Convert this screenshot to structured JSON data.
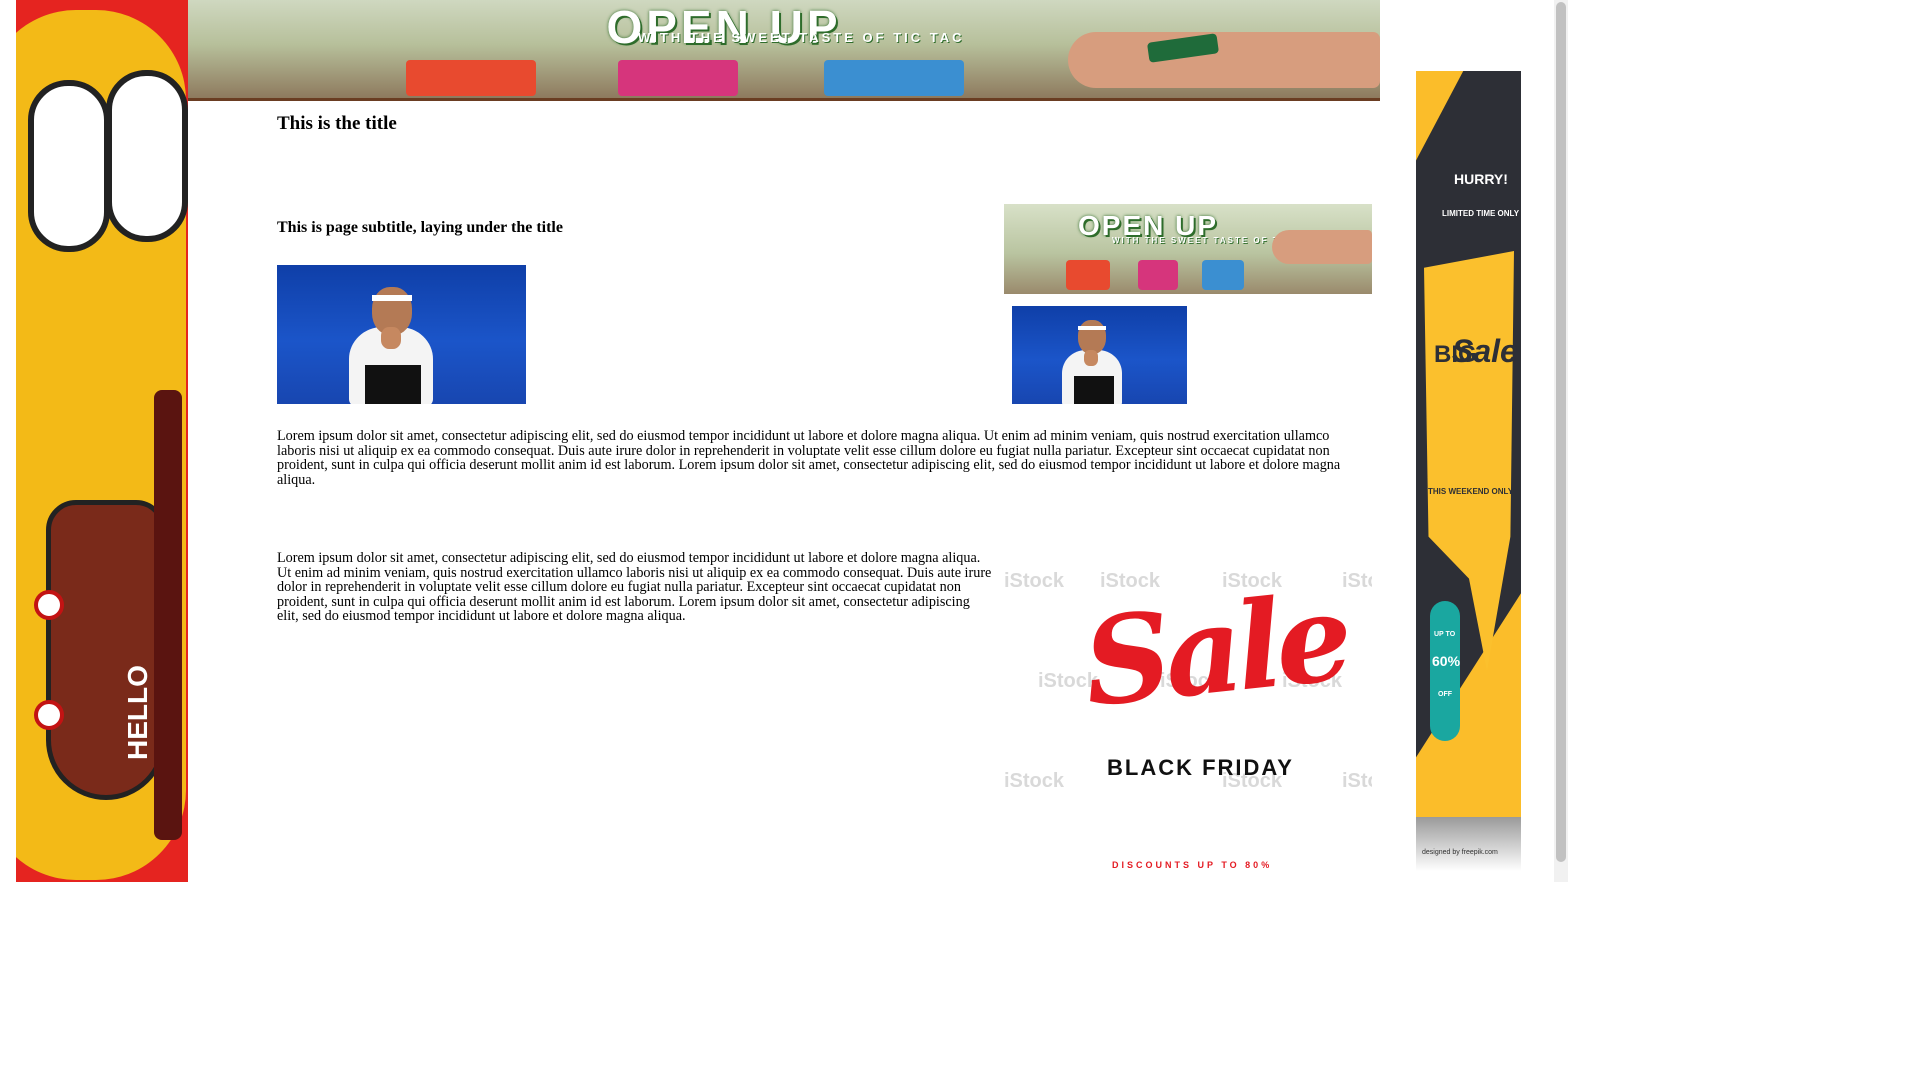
{
  "page": {
    "title": "This is the title",
    "subtitle": "This is page subtitle, laying under the title",
    "paragraphs": [
      "Lorem ipsum dolor sit amet, consectetur adipiscing elit, sed do eiusmod tempor incididunt ut labore et dolore magna aliqua. Ut enim ad minim veniam, quis nostrud exercitation ullamco laboris nisi ut aliquip ex ea commodo consequat. Duis aute irure dolor in reprehenderit in voluptate velit esse cillum dolore eu fugiat nulla pariatur. Excepteur sint occaecat cupidatat non proident, sunt in culpa qui officia deserunt mollit anim id est laborum. Lorem ipsum dolor sit amet, consectetur adipiscing elit, sed do eiusmod tempor incididunt ut labore et dolore magna aliqua.",
      "Lorem ipsum dolor sit amet, consectetur adipiscing elit, sed do eiusmod tempor incididunt ut labore et dolore magna aliqua. Ut enim ad minim veniam, quis nostrud exercitation ullamco laboris nisi ut aliquip ex ea commodo consequat. Duis aute irure dolor in reprehenderit in voluptate velit esse cillum dolore eu fugiat nulla pariatur. Excepteur sint occaecat cupidatat non proident, sunt in culpa qui officia deserunt mollit anim id est laborum. Lorem ipsum dolor sit amet, consectetur adipiscing elit, sed do eiusmod tempor incididunt ut labore et dolore magna aliqua."
    ]
  },
  "ads": {
    "tictac": {
      "headline": "OPEN UP",
      "tagline": "WITH THE SWEET TASTE OF TIC TAC",
      "brand": "tic tac",
      "colors": [
        "#e84a2f",
        "#d6357c",
        "#3b8fd1"
      ]
    },
    "left_skyscraper": {
      "text": "HELLO",
      "background": "#e52420"
    },
    "black_friday": {
      "sale_word": "Sale",
      "event": "BLACK FRIDAY",
      "discount": "DISCOUNTS UP TO 80%",
      "watermark": "iStock",
      "accent": "#e41b23"
    },
    "weekend_sale": {
      "hurry": "HURRY!",
      "limited": "LIMITED TIME ONLY",
      "big": "BIG",
      "sale": "Sale",
      "weekend": "THIS WEEKEND ONLY",
      "upto": "UP TO",
      "percent": "60%",
      "off": "OFF",
      "credit": "designed by freepik.com",
      "accent": "#fbbd2a"
    }
  },
  "icons": {
    "tennis_photo": "tennis-player-photo"
  }
}
